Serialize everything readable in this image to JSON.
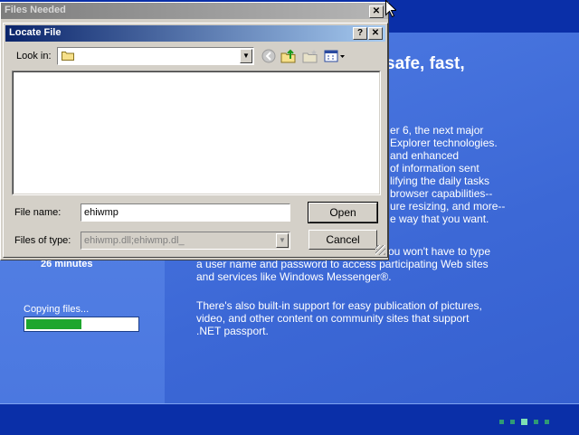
{
  "background": {
    "heading": "safe, fast,",
    "paragraph1": [
      "er 6, the next major",
      "Explorer technologies.",
      "and enhanced",
      "of information sent",
      "lifying the daily tasks",
      "browser capabilities--",
      "ure resizing, and more--",
      "e way that you want."
    ],
    "paragraph2": [
      "ou won't have to type",
      "a user name and password to access participating Web sites",
      "and services like Windows Messenger®."
    ],
    "paragraph3": [
      "There's also built-in support for easy publication of pictures,",
      "video, and other content on community sites that support",
      ".NET passport."
    ],
    "time_remaining": "26 minutes",
    "copying_label": "Copying files...",
    "progress_fraction": 0.5,
    "progress_color": "#1ea62d"
  },
  "files_needed": {
    "title": "Files Needed",
    "close_glyph": "✕"
  },
  "dialog": {
    "title": "Locate File",
    "help_glyph": "?",
    "close_glyph": "✕",
    "look_in_label": "Look in:",
    "look_in_value": "",
    "file_name_label": "File name:",
    "file_name_value": "ehiwmp",
    "files_of_type_label": "Files of type:",
    "files_of_type_value": "ehiwmp.dll;ehiwmp.dl_",
    "open_label": "Open",
    "cancel_label": "Cancel",
    "toolbar": [
      "back-icon",
      "up-folder-icon",
      "new-folder-icon",
      "view-menu-icon"
    ]
  }
}
